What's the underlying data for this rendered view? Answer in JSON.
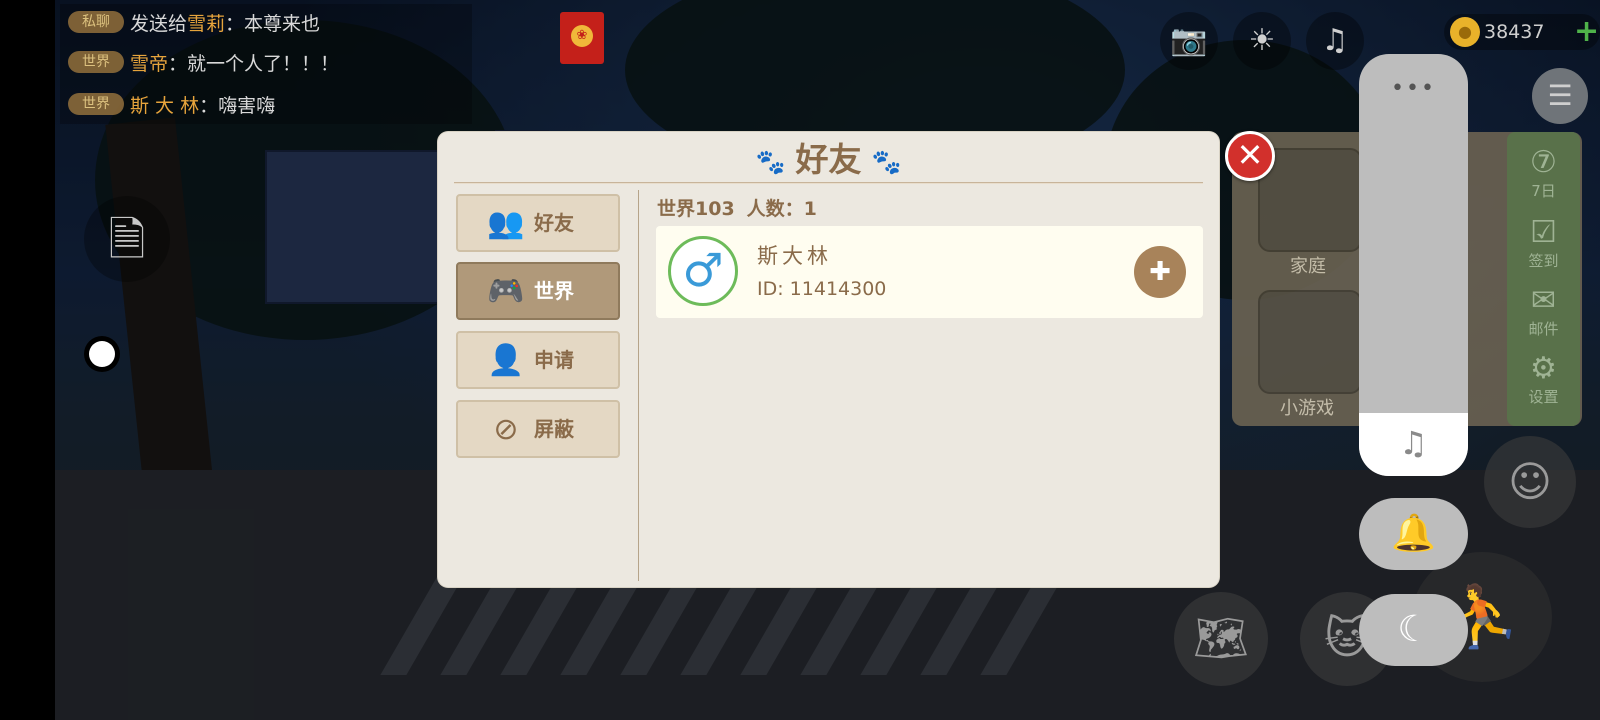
{
  "chat": [
    {
      "tag": "私聊",
      "prefix": "发送给",
      "name": "雪莉",
      "sep": "：",
      "message": "本尊来也"
    },
    {
      "tag": "世界",
      "prefix": "",
      "name": "雪帝",
      "sep": "：",
      "message": "就一个人了！！！"
    },
    {
      "tag": "世界",
      "prefix": "",
      "name": "斯 大 林",
      "sep": "：",
      "message": "嗨害嗨"
    }
  ],
  "hud": {
    "coins": "38437",
    "coin_plus": "+",
    "icons": {
      "camera": "camera-icon",
      "brightness": "sun-icon",
      "music": "music-icon",
      "menu": "list-menu-icon"
    }
  },
  "side_menu": {
    "cards": [
      {
        "label": "家庭",
        "icon": "heart-icon"
      },
      {
        "label": "小游戏",
        "icon": "gamepad-icon"
      }
    ],
    "column": [
      {
        "label": "7日",
        "icon": "seven-day-icon"
      },
      {
        "label": "签到",
        "icon": "checkin-icon"
      },
      {
        "label": "邮件",
        "icon": "mail-icon"
      },
      {
        "label": "设置",
        "icon": "gear-icon"
      }
    ]
  },
  "dialog": {
    "title": "好友",
    "tabs": [
      {
        "label": "好友",
        "icon": "friends-icon",
        "active": false
      },
      {
        "label": "世界",
        "icon": "gamepad-icon",
        "active": true
      },
      {
        "label": "申请",
        "icon": "add-friend-icon",
        "active": false
      },
      {
        "label": "屏蔽",
        "icon": "block-user-icon",
        "active": false
      }
    ],
    "room_name": "世界103",
    "count_label": "人数：1",
    "players": [
      {
        "name": "斯大林",
        "id_text": "ID: 11414300",
        "gender": "male"
      }
    ]
  },
  "sound_overlay": {
    "volume_level": 0.15,
    "dots": "•••",
    "note_glyph": "♫",
    "bell_glyph": "🔔",
    "moon_glyph": "☾"
  }
}
